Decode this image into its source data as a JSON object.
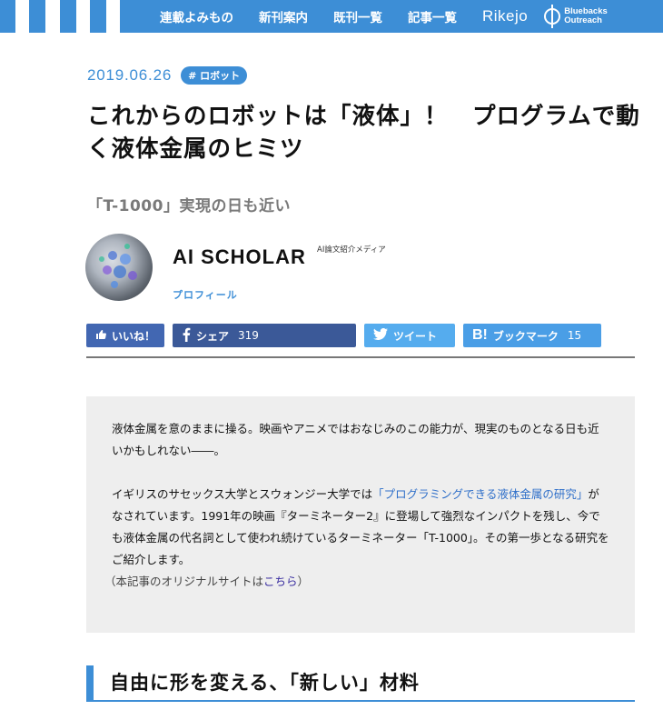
{
  "nav": {
    "items": [
      "連載よみもの",
      "新刊案内",
      "既刊一覧",
      "記事一覧"
    ],
    "rikejo": "Rikejo",
    "outreach_line1": "Bluebacks",
    "outreach_line2": "Outreach"
  },
  "article": {
    "date": "2019.06.26",
    "tag": "# ロボット",
    "title": "これからのロボットは「液体」！　プログラムで動く液体金属のヒミツ",
    "subtitle": "「T-1000」実現の日も近い"
  },
  "author": {
    "name": "AI SCHOLAR",
    "role": "AI論文紹介メディア",
    "profile_link": "プロフィール"
  },
  "share": {
    "like_label": "いいね！",
    "facebook_label": "シェア",
    "facebook_count": "319",
    "twitter_label": "ツイート",
    "hatena_label": "ブックマーク",
    "hatena_count": "15"
  },
  "lead": {
    "p1": "液体金属を意のままに操る。映画やアニメではおなじみのこの能力が、現実のものとなる日も近いかもしれない――。",
    "p2_before": "イギリスのサセックス大学とスウォンジー大学では",
    "p2_link": "「プログラミングできる液体金属の研究」",
    "p2_after": "がなされています。1991年の映画『ターミネーター2』に登場して強烈なインパクトを残し、今でも液体金属の代名詞として使われ続けているターミネーター「T-1000」。その第一歩となる研究をご紹介します。",
    "note_before": "（本記事のオリジナルサイトは",
    "note_link": "こちら",
    "note_after": "）"
  },
  "section_heading": "自由に形を変える、「新しい」材料",
  "colors": {
    "accent": "#3d8ed6",
    "facebook": "#3b5998",
    "twitter": "#55acee",
    "hatena": "#4a9ee6",
    "lead_bg": "#eeeeee"
  }
}
